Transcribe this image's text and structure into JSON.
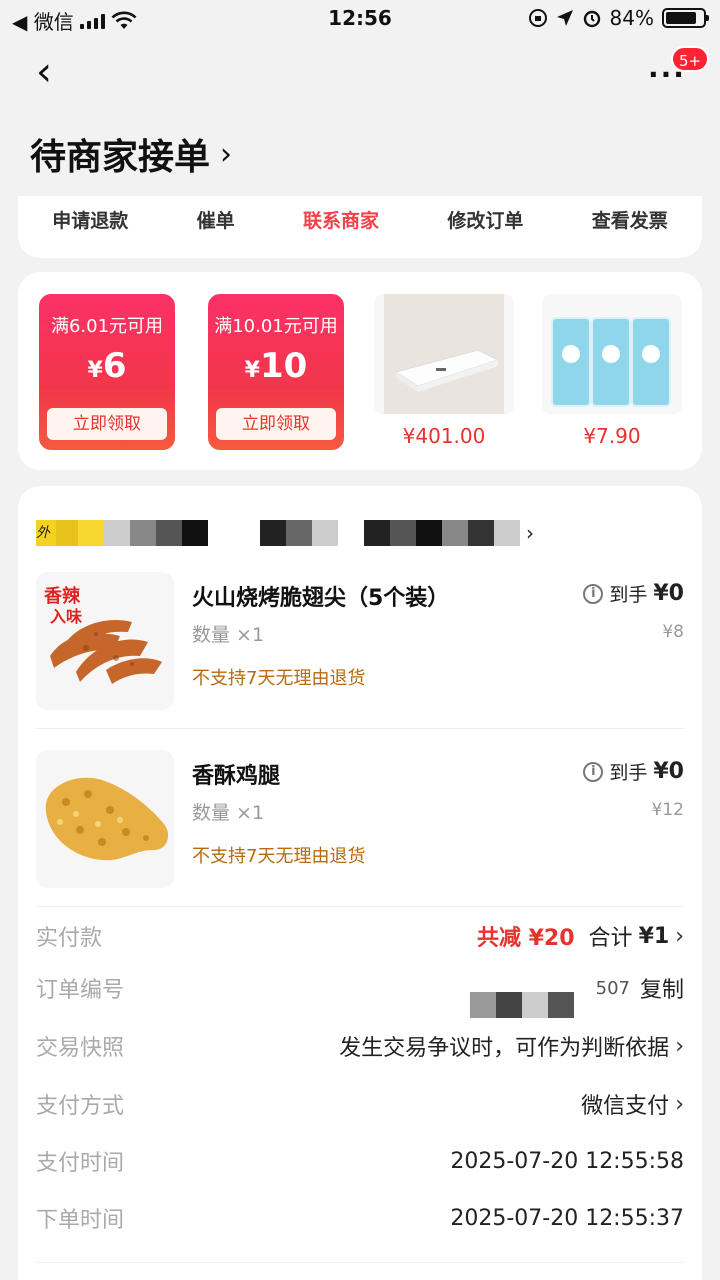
{
  "status_bar": {
    "carrier": "◀ 微信",
    "time": "12:56",
    "battery": "84%"
  },
  "nav": {
    "back_label": "‹",
    "more_label": "···",
    "badge": "5+"
  },
  "page": {
    "title": "待商家接单",
    "title_chevron": "›"
  },
  "actions": [
    "申请退款",
    "催单",
    "联系商家",
    "修改订单",
    "查看发票"
  ],
  "promos": {
    "coupons": [
      {
        "condition": "满6.01元可用",
        "currency": "¥",
        "amount": "6",
        "button": "立即领取"
      },
      {
        "condition": "满10.01元可用",
        "currency": "¥",
        "amount": "10",
        "button": "立即领取"
      }
    ],
    "products": [
      {
        "price": "¥401.00"
      },
      {
        "price": "¥7.90"
      }
    ]
  },
  "shop": {
    "name_visible": "外",
    "chevron": "›"
  },
  "items": [
    {
      "name": "火山烧烤脆翅尖（5个装）",
      "qty": "数量 ×1",
      "policy": "不支持7天无理由退货",
      "got_label": "到手",
      "got_value": "¥0",
      "orig_price": "¥8",
      "image_text": "香辣\n入味"
    },
    {
      "name": "香酥鸡腿",
      "qty": "数量 ×1",
      "policy": "不支持7天无理由退货",
      "got_label": "到手",
      "got_value": "¥0",
      "orig_price": "¥12"
    }
  ],
  "summary": {
    "paid_label": "实付款",
    "saved": "共减 ¥20",
    "total_prefix": "合计",
    "total": "¥1",
    "order_no_label": "订单编号",
    "order_no_visible": "507",
    "copy": "复制",
    "snapshot_label": "交易快照",
    "snapshot_value": "发生交易争议时，可作为判断依据",
    "pay_method_label": "支付方式",
    "pay_method_value": "微信支付",
    "pay_time_label": "支付时间",
    "pay_time_value": "2025-07-20 12:55:58",
    "order_time_label": "下单时间",
    "order_time_value": "2025-07-20 12:55:37"
  },
  "colors": {
    "accent": "#f3414b",
    "policy": "#b46b14",
    "coupon": "#f2364a"
  }
}
